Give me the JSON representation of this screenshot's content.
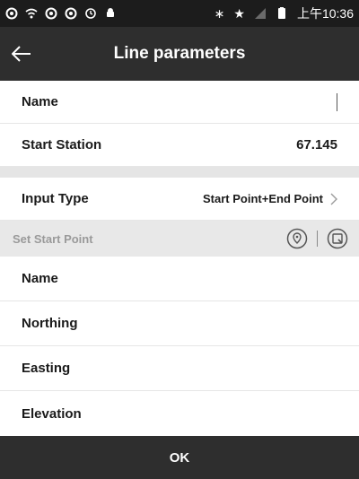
{
  "status_bar": {
    "time": "上午10:36",
    "icons": [
      "app-icon",
      "wifi-icon",
      "app-icon",
      "app-icon",
      "sync-icon",
      "android-icon",
      "bluetooth-icon",
      "star-icon",
      "signal-icon",
      "battery-icon"
    ]
  },
  "header": {
    "title": "Line parameters",
    "back_icon": "arrow-left-icon"
  },
  "line": {
    "name_label": "Name",
    "name_value": "",
    "start_station_label": "Start Station",
    "start_station_value": "67.145",
    "input_type_label": "Input Type",
    "input_type_value": "Start Point+End Point"
  },
  "start_point_section": {
    "title": "Set Start Point",
    "icons": [
      "location-pin-icon",
      "map-select-icon"
    ]
  },
  "start_point": {
    "name_label": "Name",
    "northing_label": "Northing",
    "easting_label": "Easting",
    "elevation_label": "Elevation"
  },
  "footer": {
    "ok_label": "OK"
  }
}
